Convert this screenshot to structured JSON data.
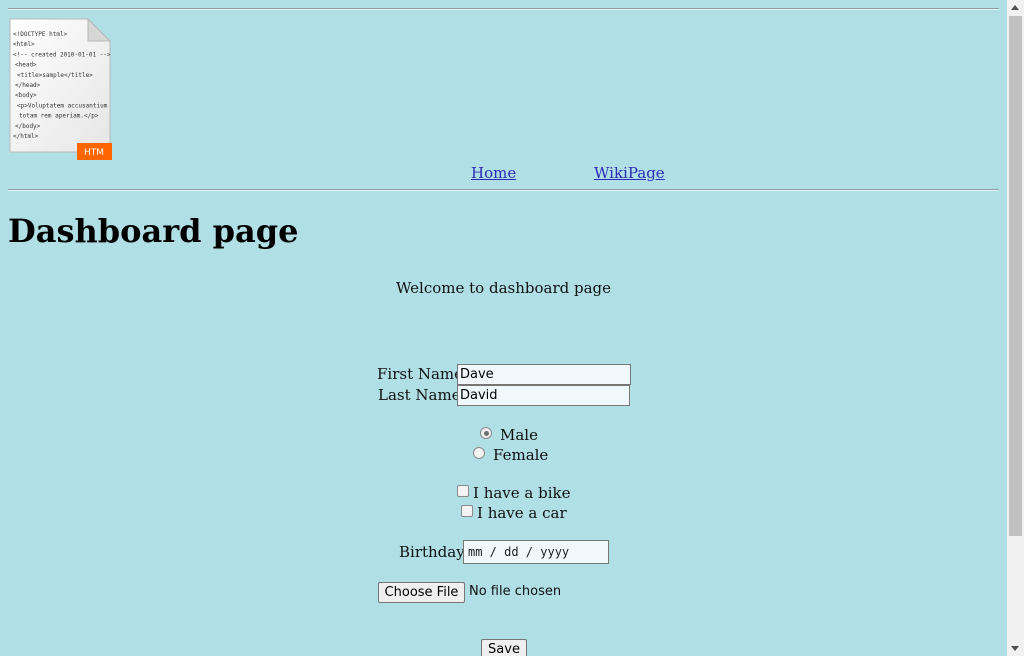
{
  "logo": {
    "icon": "html-file-icon",
    "code_lines": [
      "<!DOCTYPE html>",
      "<html>",
      "<!-- created 2010-01-01 -->",
      "<head>",
      "<title>sample</title>",
      "</head>",
      "<body>",
      "<p>Voluptatem accusantium",
      "totam rem aperiam.</p>",
      "</body>",
      "</html>"
    ],
    "badge": "HTM",
    "badge_color": "#ff6600"
  },
  "nav": {
    "home": "Home",
    "wiki": "WikiPage"
  },
  "page": {
    "title": "Dashboard page",
    "welcome": "Welcome to dashboard page"
  },
  "form": {
    "first_name_label": "First Name:",
    "first_name_value": "Dave",
    "last_name_label": "Last Name:",
    "last_name_value": "David",
    "gender_male": "Male",
    "gender_female": "Female",
    "gender_selected": "Male",
    "bike_label": "I have a bike",
    "car_label": "I have a car",
    "birthday_label": "Birthday:",
    "birthday_placeholder": "mm / dd / yyyy",
    "choose_file": "Choose File",
    "file_status": "No file chosen",
    "save": "Save"
  },
  "colors": {
    "background": "#b0dfe5",
    "link": "#2b2bb6"
  }
}
